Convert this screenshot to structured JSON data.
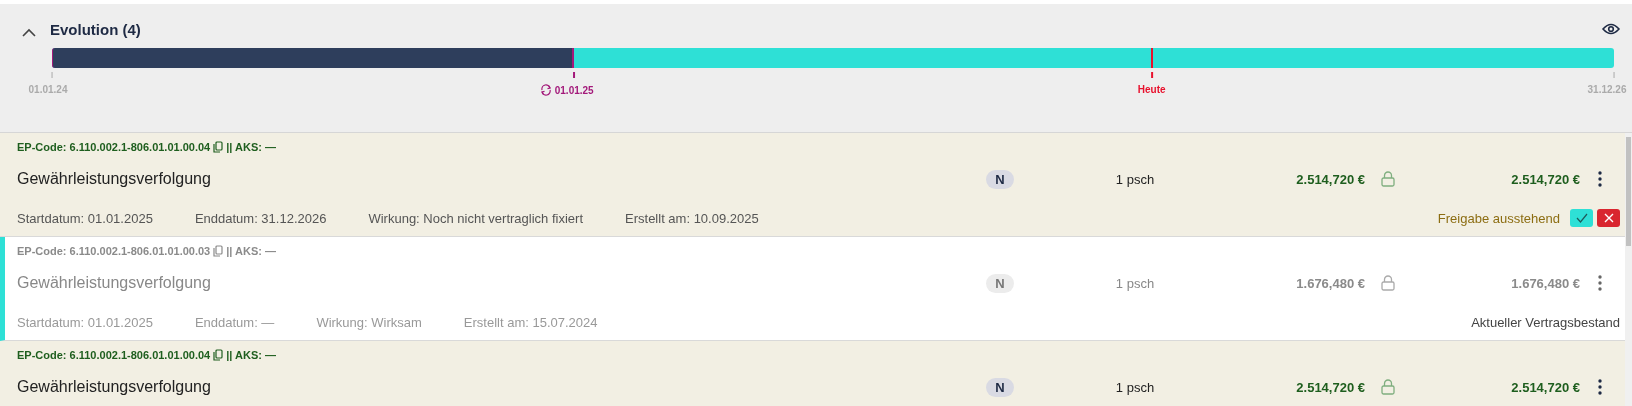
{
  "header": {
    "title": "Evolution (4)",
    "expanded": true,
    "timeline": {
      "level": 0.334,
      "markers": [
        {
          "label": "01.01.24",
          "kind": "start"
        },
        {
          "label": "01.01.25",
          "kind": "change"
        },
        {
          "label": "Heute",
          "kind": "today"
        },
        {
          "label": "31.12.26",
          "kind": "end"
        }
      ]
    }
  },
  "rows": [
    {
      "kind": "pending",
      "code": "EP-Code: 6.110.002.1-806.01.01.00.04",
      "aks": "|| AKS: —",
      "name": "Gewährleistungsverfolgung",
      "badge": "N",
      "quantity": "1 psch",
      "amount": "2.514,720 €",
      "total": "2.514,720 €",
      "meta": [
        "Startdatum: 01.01.2025",
        "Enddatum: 31.12.2026",
        "Wirkung: Noch nicht vertraglich fixiert",
        "Erstellt am: 10.09.2025"
      ],
      "status": "Freigabe ausstehend",
      "actions": true
    },
    {
      "kind": "current",
      "code": "EP-Code: 6.110.002.1-806.01.01.00.03",
      "aks": "|| AKS: —",
      "name": "Gewährleistungsverfolgung",
      "badge": "N",
      "quantity": "1 psch",
      "amount": "1.676,480 €",
      "total": "1.676,480 €",
      "meta": [
        "Startdatum: 01.01.2025",
        "Enddatum: —",
        "Wirkung: Wirksam",
        "Erstellt am: 15.07.2024"
      ],
      "status": "Aktueller Vertragsbestand",
      "actions": false
    },
    {
      "kind": "pending",
      "code": "EP-Code: 6.110.002.1-806.01.01.00.04",
      "aks": "|| AKS: —",
      "name": "Gewährleistungsverfolgung",
      "badge": "N",
      "quantity": "1 psch",
      "amount": "2.514,720 €",
      "total": "2.514,720 €",
      "meta": []
    }
  ]
}
